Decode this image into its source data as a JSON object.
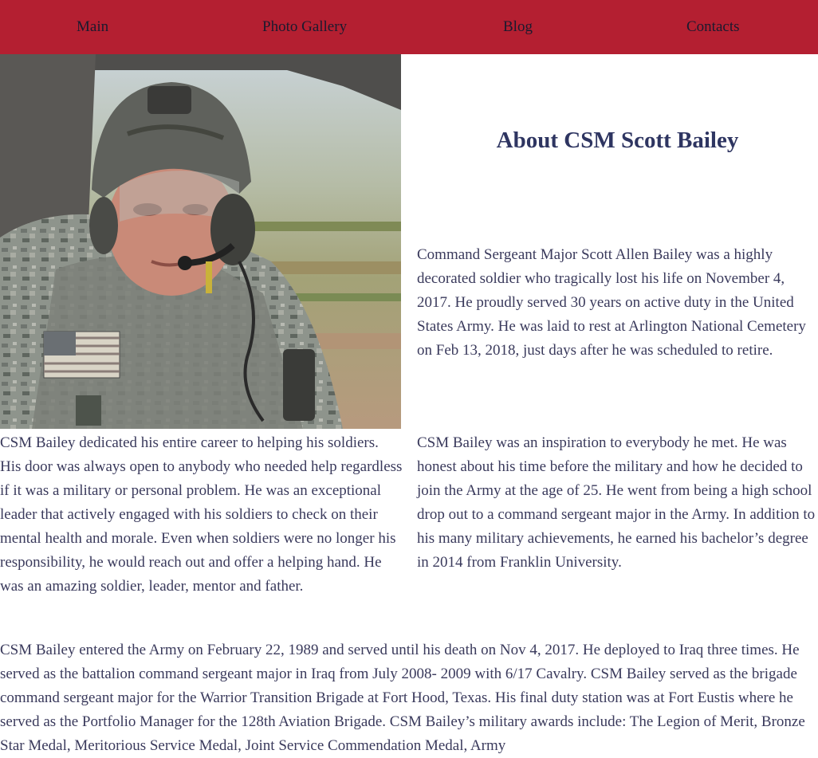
{
  "nav": {
    "items": [
      {
        "label": "Main"
      },
      {
        "label": "Photo Gallery"
      },
      {
        "label": "Blog"
      },
      {
        "label": "Contacts"
      }
    ]
  },
  "colors": {
    "nav_background": "#b41f31",
    "nav_text": "#1a1a2e",
    "title": "#2e3561",
    "body_text": "#3a3a5c"
  },
  "photo": {
    "subject": "soldier-in-helicopter-photo"
  },
  "page": {
    "title": "About CSM Scott Bailey",
    "paragraph_1": "Command Sergeant Major Scott Allen Bailey was a highly decorated soldier who tragically lost his life on November 4, 2017. He proudly served 30 years on active duty in the United States Army. He was laid to rest at Arlington National Cemetery on Feb 13, 2018, just days after he was scheduled to retire.",
    "paragraph_2": "CSM Bailey dedicated his entire career to helping his soldiers. His door was always open to anybody who needed help regardless if it was a military or personal problem. He was an exceptional leader that actively engaged with his soldiers to check on their mental health and morale. Even when soldiers were no longer his responsibility, he would reach out and offer a helping hand. He was an amazing soldier, leader, mentor and father.",
    "paragraph_3": "CSM Bailey was an inspiration to everybody he met. He was honest about his time before the military and how he decided to join the Army at the age of 25. He went from being a high school drop out to a command sergeant major in the Army. In addition to his many military achievements, he earned his bachelor’s degree in 2014 from Franklin University.",
    "paragraph_4": "CSM Bailey entered the Army on February 22, 1989 and served until his death on Nov 4, 2017. He deployed to Iraq three times. He served as the battalion command sergeant major in Iraq from July 2008- 2009 with 6/17 Cavalry. CSM Bailey served as the brigade command sergeant major for the Warrior Transition Brigade at Fort Hood, Texas. His final duty station was at Fort Eustis where he served as the Portfolio Manager for the 128th Aviation Brigade. CSM Bailey’s military awards include: The Legion of Merit, Bronze Star Medal, Meritorious Service Medal, Joint Service Commendation Medal, Army"
  }
}
